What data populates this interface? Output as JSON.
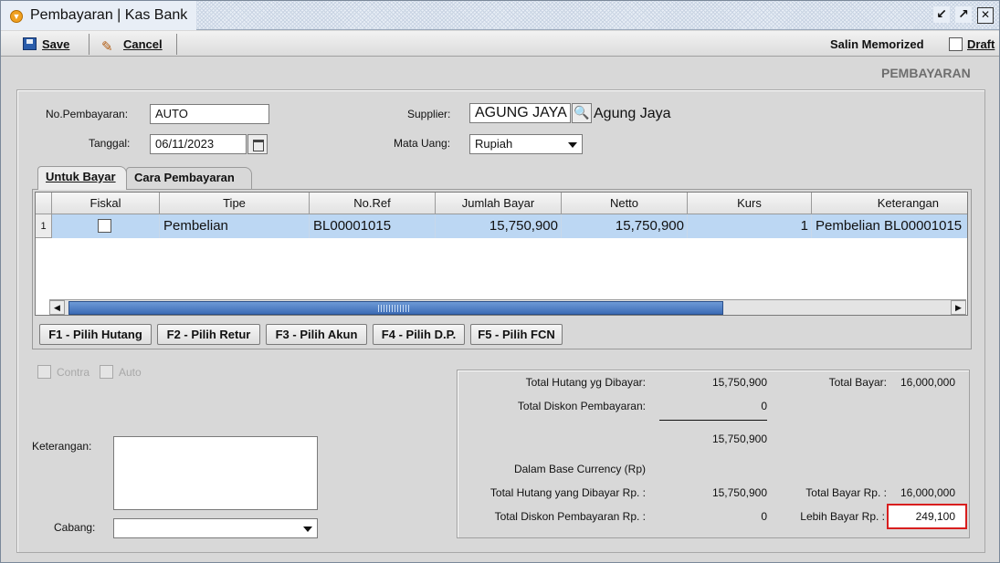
{
  "window": {
    "title": "Pembayaran | Kas Bank",
    "controls": [
      "restore",
      "maximize",
      "close"
    ]
  },
  "toolbar": {
    "save_label": "Save",
    "cancel_label": "Cancel",
    "memorized_label": "Salin Memorized",
    "draft_label": "Draft",
    "draft_checked": false
  },
  "page_heading": "PEMBAYARAN",
  "form": {
    "no_pembayaran_label": "No.Pembayaran:",
    "no_pembayaran_value": "AUTO",
    "tanggal_label": "Tanggal:",
    "tanggal_value": "06/11/2023",
    "supplier_label": "Supplier:",
    "supplier_code": "AGUNG JAYA",
    "supplier_name": "Agung Jaya",
    "mata_uang_label": "Mata Uang:",
    "mata_uang_value": "Rupiah"
  },
  "tabs": [
    {
      "label": "Untuk Bayar",
      "active": true
    },
    {
      "label": "Cara Pembayaran",
      "active": false
    }
  ],
  "grid": {
    "columns": [
      "Fiskal",
      "Tipe",
      "No.Ref",
      "Jumlah Bayar",
      "Netto",
      "Kurs",
      "Keterangan"
    ],
    "rows": [
      {
        "num": "1",
        "fiskal": false,
        "tipe": "Pembelian",
        "no_ref": "BL00001015",
        "jumlah_bayar": "15,750,900",
        "netto": "15,750,900",
        "kurs": "1",
        "keterangan": "Pembelian BL00001015"
      }
    ]
  },
  "function_buttons": [
    "F1 - Pilih Hutang",
    "F2 - Pilih Retur",
    "F3 - Pilih Akun",
    "F4 - Pilih D.P.",
    "F5 - Pilih FCN"
  ],
  "options": {
    "contra_label": "Contra",
    "auto_label": "Auto"
  },
  "notes": {
    "keterangan_label": "Keterangan:",
    "keterangan_value": "",
    "cabang_label": "Cabang:",
    "cabang_value": ""
  },
  "summary": {
    "total_hutang_label": "Total Hutang yg Dibayar:",
    "total_hutang_value": "15,750,900",
    "total_diskon_label": "Total Diskon Pembayaran:",
    "total_diskon_value": "0",
    "subtotal_value": "15,750,900",
    "base_currency_label": "Dalam Base Currency (Rp)",
    "total_hutang_rp_label": "Total Hutang yang Dibayar Rp. :",
    "total_hutang_rp_value": "15,750,900",
    "total_diskon_rp_label": "Total Diskon Pembayaran Rp. :",
    "total_diskon_rp_value": "0",
    "total_bayar_label": "Total Bayar:",
    "total_bayar_value": "16,000,000",
    "total_bayar_rp_label": "Total Bayar Rp. :",
    "total_bayar_rp_value": "16,000,000",
    "lebih_bayar_label": "Lebih Bayar Rp. :",
    "lebih_bayar_value": "249,100"
  },
  "colors": {
    "selected_row": "#bcd7f3",
    "highlight_border": "#d81e1e",
    "scroll_thumb": "#3c6cb6"
  }
}
